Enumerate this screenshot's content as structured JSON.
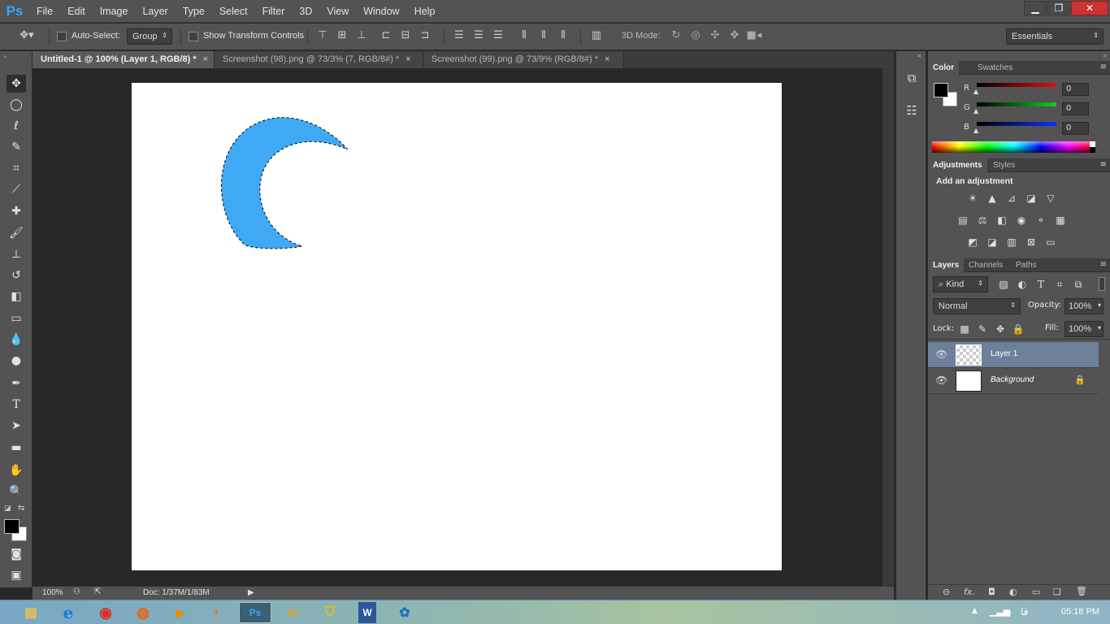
{
  "app": {
    "logo": "Ps"
  },
  "menubar": {
    "items": [
      "File",
      "Edit",
      "Image",
      "Layer",
      "Type",
      "Select",
      "Filter",
      "3D",
      "View",
      "Window",
      "Help"
    ],
    "window_controls": {
      "minimize": "▁",
      "restore": "❐",
      "close": "✕"
    }
  },
  "options": {
    "auto_select_label": "Auto-Select:",
    "auto_select_value": "Group",
    "show_transform_label": "Show Transform Controls",
    "mode_3d_label": "3D Mode:",
    "workspace": "Essentials"
  },
  "tabs": [
    {
      "label": "Untitled-1 @ 100% (Layer 1, RGB/8) *",
      "close": "×",
      "active": true
    },
    {
      "label": "Screenshot (98).png @ 73/3% (7, RGB/8#) *",
      "close": "×",
      "active": false
    },
    {
      "label": "Screenshot (99).png @ 73/9% (RGB/8#) *",
      "close": "×",
      "active": false
    }
  ],
  "status": {
    "zoom": "100%",
    "doc": "Doc: 1/37M/1/83M",
    "arrow": "▶"
  },
  "color_panel": {
    "tabs": [
      "Color",
      "Swatches"
    ],
    "menu": "≡",
    "channels": [
      {
        "label": "R",
        "value": "0",
        "color": "#e01010"
      },
      {
        "label": "G",
        "value": "0",
        "color": "#10d020"
      },
      {
        "label": "B",
        "value": "0",
        "color": "#1030ff"
      }
    ],
    "foreground": "#000000",
    "background": "#ffffff"
  },
  "adjustments_panel": {
    "tabs": [
      "Adjustments",
      "Styles"
    ],
    "menu": "≡",
    "heading": "Add an adjustment"
  },
  "layers_panel": {
    "tabs": [
      "Layers",
      "Channels",
      "Paths"
    ],
    "menu": "≡",
    "filter_kind": "Kind",
    "blend_mode": "Normal",
    "opacity_label": "Opacity:",
    "opacity_value": "100%",
    "lock_label": "Lock:",
    "fill_label": "Fill:",
    "fill_value": "100%",
    "layers": [
      {
        "name": "Layer 1",
        "selected": true
      },
      {
        "name": "Background",
        "selected": false
      }
    ],
    "footer_icons": [
      "link-icon",
      "fx-icon",
      "mask-icon",
      "adjustment-icon",
      "folder-icon",
      "new-layer-icon",
      "trash-icon"
    ],
    "footer_glyphs": [
      "⊝",
      "fx.",
      "◘",
      "◐",
      "▭",
      "❏",
      "🗑"
    ]
  },
  "canvas": {
    "shape_color": "#3fa9f5"
  },
  "taskbar": {
    "apps": [
      {
        "name": "explorer",
        "glyph": "▤"
      },
      {
        "name": "ie",
        "glyph": "e"
      },
      {
        "name": "chrome",
        "glyph": "◉"
      },
      {
        "name": "firefox",
        "glyph": "◍"
      },
      {
        "name": "media",
        "glyph": "▶"
      },
      {
        "name": "blender",
        "glyph": "◐"
      },
      {
        "name": "photoshop",
        "glyph": "Ps"
      },
      {
        "name": "illustrator",
        "glyph": "Ai"
      },
      {
        "name": "shield",
        "glyph": "⛉"
      },
      {
        "name": "word",
        "glyph": "W"
      },
      {
        "name": "app",
        "glyph": "✿"
      }
    ],
    "tray_language": "فا",
    "time": "05:18 PM"
  }
}
